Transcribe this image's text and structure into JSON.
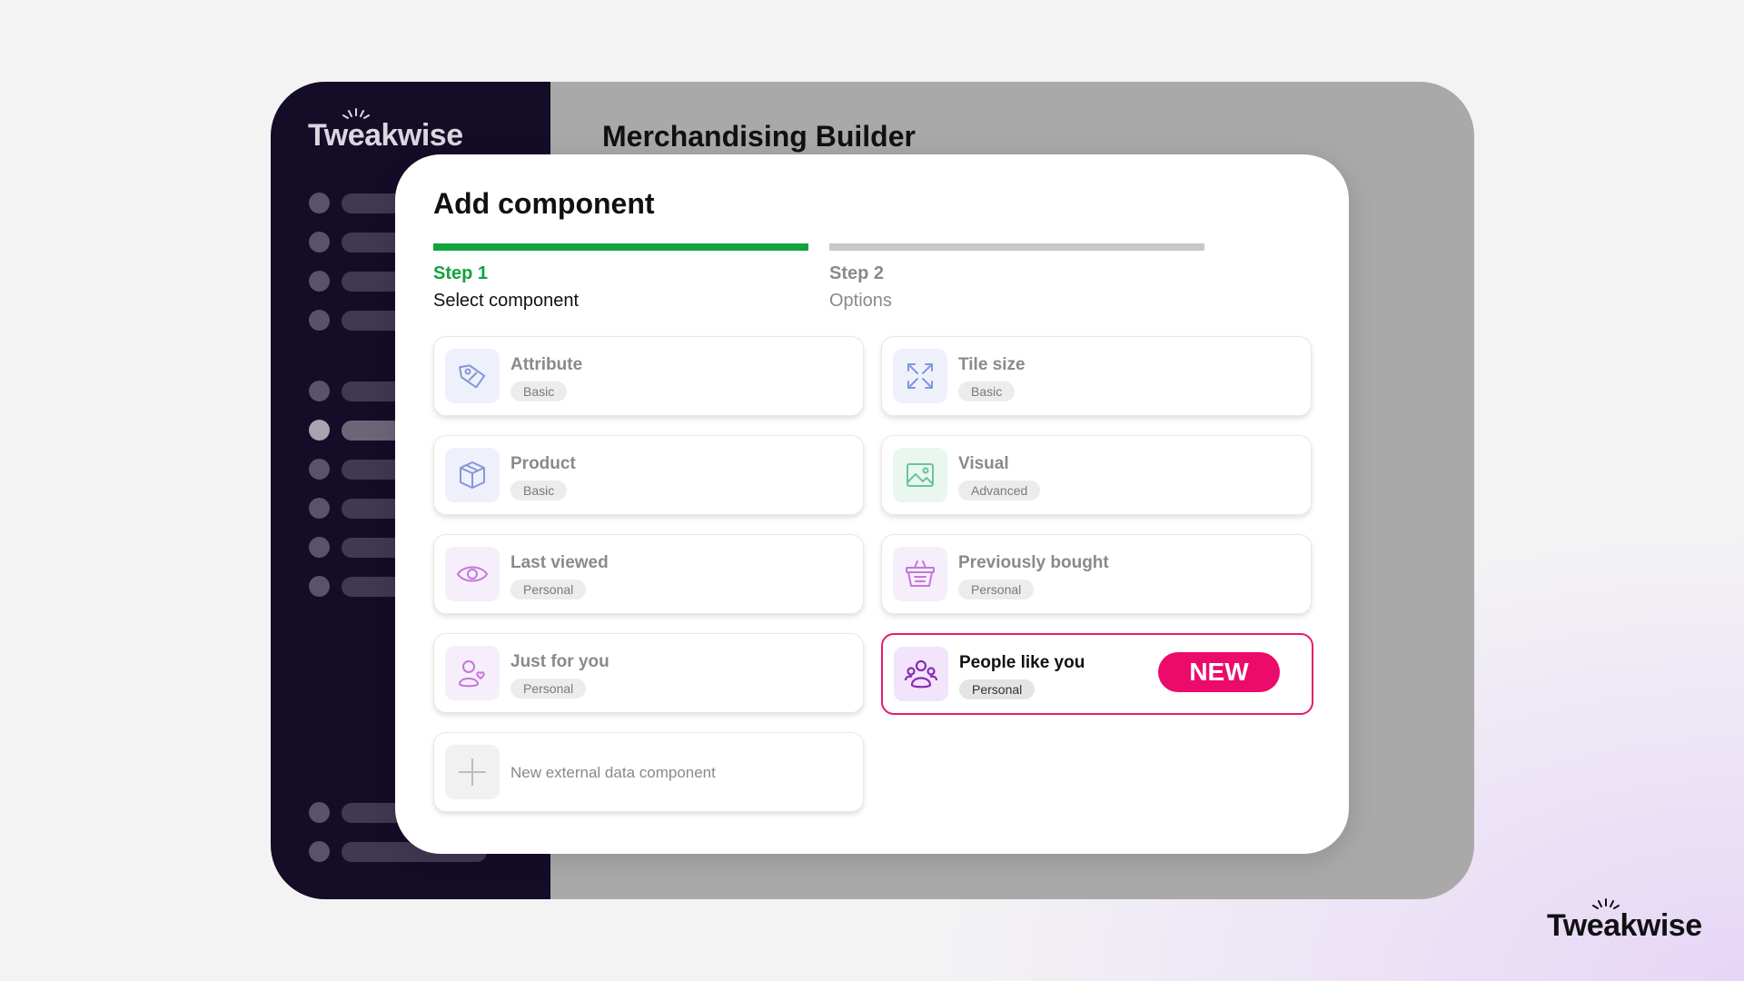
{
  "app": {
    "logo_text": "Tweakwise",
    "page_title": "Merchandising Builder"
  },
  "modal": {
    "title": "Add component",
    "steps": [
      {
        "number": "Step 1",
        "label": "Select component",
        "state": "active",
        "color": "#12a33e"
      },
      {
        "number": "Step 2",
        "label": "Options",
        "state": "inactive",
        "color": "#8a8a8a"
      }
    ],
    "components": [
      {
        "name": "Attribute",
        "badge": "Basic",
        "icon": "tag-icon"
      },
      {
        "name": "Tile size",
        "badge": "Basic",
        "icon": "expand-arrows-icon"
      },
      {
        "name": "Product",
        "badge": "Basic",
        "icon": "box-icon"
      },
      {
        "name": "Visual",
        "badge": "Advanced",
        "icon": "image-icon"
      },
      {
        "name": "Last viewed",
        "badge": "Personal",
        "icon": "eye-icon"
      },
      {
        "name": "Previously bought",
        "badge": "Personal",
        "icon": "basket-icon"
      },
      {
        "name": "Just for you",
        "badge": "Personal",
        "icon": "user-heart-icon"
      },
      {
        "name": "People like you",
        "badge": "Personal",
        "icon": "users-group-icon",
        "tag": "NEW",
        "highlighted": true
      }
    ],
    "external": {
      "label": "New external data component",
      "icon": "plus-icon"
    }
  },
  "brand_footer": {
    "logo_text": "Tweakwise"
  },
  "colors": {
    "accent_green": "#12a33e",
    "new_badge": "#ec0a6b",
    "sidebar_bg": "#150c28"
  }
}
